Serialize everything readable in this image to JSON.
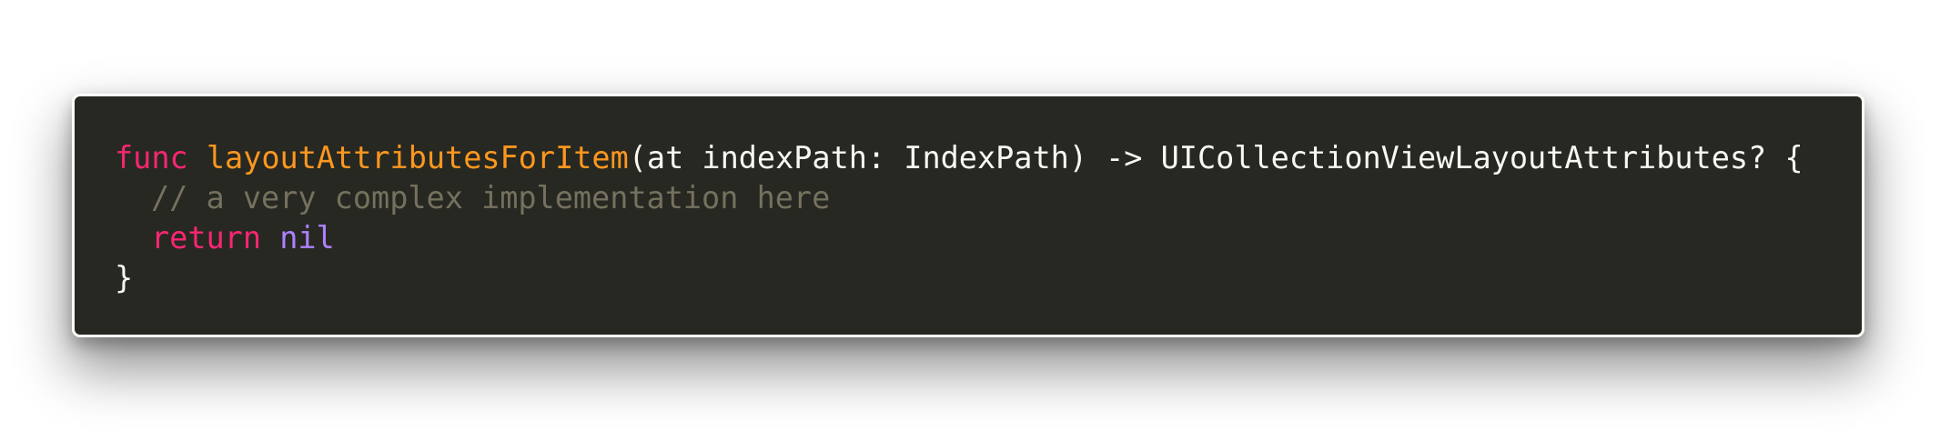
{
  "code": {
    "line1": {
      "keyword": "func",
      "function_name": "layoutAttributesForItem",
      "signature": "(at indexPath: IndexPath) -> UICollectionViewLayoutAttributes? {"
    },
    "line2": {
      "comment": "// a very complex implementation here"
    },
    "line3": {
      "keyword": "return",
      "value": "nil"
    },
    "line4": {
      "text": "}"
    }
  },
  "colors": {
    "background": "#272822",
    "keyword": "#f92672",
    "function": "#fd971f",
    "comment": "#75715e",
    "constant": "#ae81ff",
    "plain": "#f8f8f2"
  }
}
